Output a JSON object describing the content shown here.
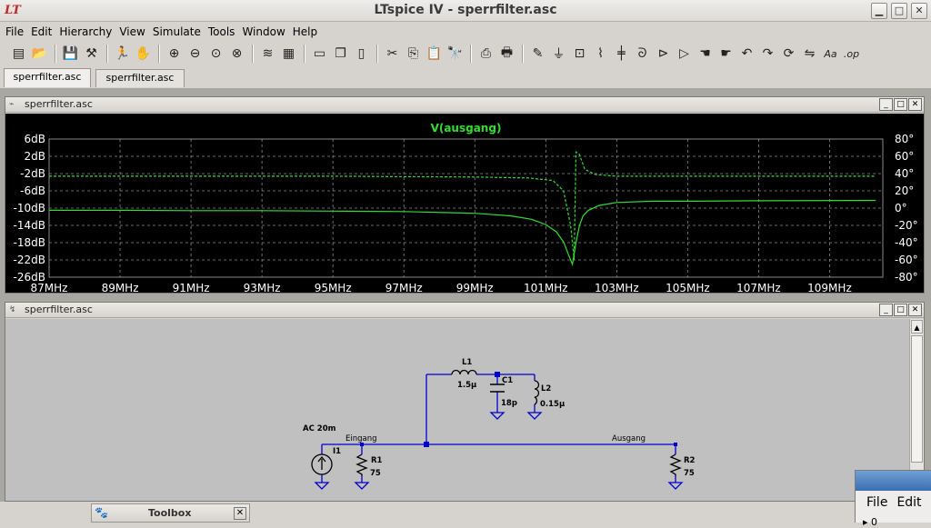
{
  "window": {
    "title": "LTspice IV - sperrfilter.asc",
    "logo": "LT"
  },
  "menu": [
    "File",
    "Edit",
    "Hierarchy",
    "View",
    "Simulate",
    "Tools",
    "Window",
    "Help"
  ],
  "toolbar_icons": [
    "new-schematic-icon",
    "open-icon",
    "save-icon",
    "control-panel-icon",
    "run-icon",
    "halt-icon",
    "zoom-in-icon",
    "zoom-out-icon",
    "zoom-fit-icon",
    "zoom-cancel-icon",
    "autorange-icon",
    "grid-icon",
    "tile-horizontal-icon",
    "cascade-icon",
    "tile-vertical-icon",
    "cut-icon",
    "copy-icon",
    "paste-icon",
    "find-icon",
    "print-setup-icon",
    "print-icon",
    "wire-icon",
    "ground-icon",
    "label-icon",
    "resistor-icon",
    "capacitor-icon",
    "inductor-icon",
    "diode-icon",
    "component-icon",
    "move-icon",
    "drag-icon",
    "undo-icon",
    "redo-icon",
    "rotate-icon",
    "mirror-icon",
    "text-icon",
    "spice-directive-icon"
  ],
  "tabs": [
    {
      "label": "sperrfilter.asc",
      "active": true
    },
    {
      "label": "sperrfilter.asc",
      "active": false
    }
  ],
  "plot_window": {
    "title": "sperrfilter.asc",
    "controls": [
      "_",
      "□",
      "✕"
    ]
  },
  "schematic_window": {
    "title": "sperrfilter.asc",
    "controls": [
      "_",
      "□",
      "✕"
    ]
  },
  "chart_data": {
    "type": "line",
    "title": "V(ausgang)",
    "xlabel": "",
    "ylabel": "",
    "x_ticks": [
      "87MHz",
      "89MHz",
      "91MHz",
      "93MHz",
      "95MHz",
      "97MHz",
      "99MHz",
      "101MHz",
      "103MHz",
      "105MHz",
      "107MHz",
      "109MHz"
    ],
    "y_ticks_left": [
      "6dB",
      "2dB",
      "-2dB",
      "-6dB",
      "-10dB",
      "-14dB",
      "-18dB",
      "-22dB",
      "-26dB"
    ],
    "y_ticks_right": [
      "80°",
      "60°",
      "40°",
      "20°",
      "0°",
      "-20°",
      "-40°",
      "-60°",
      "-80°"
    ],
    "xlim": [
      87,
      110.5
    ],
    "ylim_left": [
      -26,
      6
    ],
    "ylim_right": [
      -80,
      80
    ],
    "grid": true,
    "colors": {
      "background": "#000000",
      "trace": "#33dd33",
      "grid": "#8a8a8a",
      "text": "#ffffff",
      "title": "#33dd33"
    },
    "series": [
      {
        "name": "V(ausgang) magnitude",
        "unit": "dB",
        "style": "solid",
        "x": [
          87,
          89,
          91,
          93,
          95,
          97,
          99,
          100,
          100.6,
          101,
          101.3,
          101.5,
          101.65,
          101.75,
          101.85,
          101.95,
          102.05,
          102.2,
          102.5,
          103,
          104,
          105,
          107,
          110.3
        ],
        "y": [
          -10.5,
          -10.5,
          -10.6,
          -10.6,
          -10.7,
          -10.8,
          -11.2,
          -11.8,
          -12.6,
          -13.8,
          -15.5,
          -17.8,
          -21,
          -23,
          -18,
          -14,
          -11.8,
          -10.5,
          -9.4,
          -8.7,
          -8.4,
          -8.4,
          -8.3,
          -8.2
        ]
      },
      {
        "name": "V(ausgang) phase",
        "unit": "deg",
        "style": "dashed",
        "x": [
          87,
          90,
          95,
          99,
          100.5,
          101.2,
          101.5,
          101.7,
          101.8,
          101.85,
          101.95,
          102.1,
          102.4,
          103,
          104,
          107,
          110.3
        ],
        "y": [
          37,
          37,
          37,
          36,
          35,
          32,
          20,
          -20,
          -60,
          65,
          62,
          45,
          39,
          37,
          37,
          37,
          37
        ]
      }
    ]
  },
  "schematic": {
    "components": [
      {
        "name": "L1",
        "value": "1.5µ"
      },
      {
        "name": "C1",
        "value": "18p"
      },
      {
        "name": "L2",
        "value": "0.15µ"
      },
      {
        "name": "I1",
        "value": "AC 20m"
      },
      {
        "name": "R1",
        "value": "75"
      },
      {
        "name": "R2",
        "value": "75"
      }
    ],
    "net_labels": [
      "Eingang",
      "Ausgang"
    ],
    "colors": {
      "wire": "#0000cc",
      "background": "#c0c0c0",
      "text": "#000000"
    }
  },
  "toolbox": {
    "label": "Toolbox",
    "close": "✕"
  },
  "mini_window": {
    "menu": [
      "File",
      "Edit"
    ],
    "row_text": "0"
  }
}
